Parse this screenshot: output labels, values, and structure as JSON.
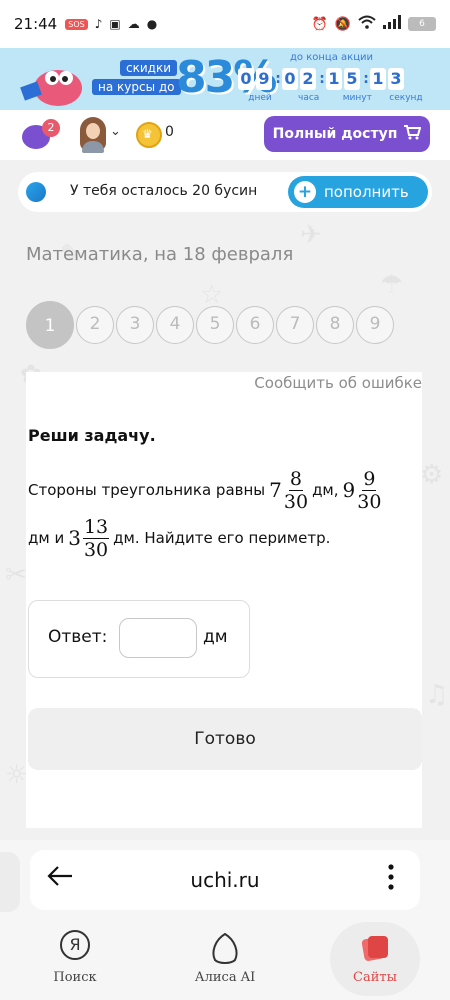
{
  "status_bar": {
    "time": "21:44",
    "sos": "SOS",
    "battery": "6"
  },
  "promo": {
    "line1": "скидки",
    "line2": "на курсы до",
    "percent": "83%",
    "until_label": "до конца акции",
    "timer": {
      "days": [
        "0",
        "9"
      ],
      "hours": [
        "0",
        "2"
      ],
      "minutes": [
        "1",
        "5"
      ],
      "seconds": [
        "1",
        "3"
      ],
      "days_label": "дней",
      "hours_label": "часа",
      "minutes_label": "минут",
      "seconds_label": "секунд"
    }
  },
  "header": {
    "chat_badge": "2",
    "coins": "0",
    "full_access_label": "Полный доступ"
  },
  "beads": {
    "text": "У тебя осталось 20 бусин",
    "topup_label": "пополнить"
  },
  "subject_title": "Математика, на 18 февраля",
  "task_nav": [
    "1",
    "2",
    "3",
    "4",
    "5",
    "6",
    "7",
    "8",
    "9"
  ],
  "card": {
    "report_label": "Сообщить об ошибке",
    "heading": "Реши задачу.",
    "problem": {
      "intro": "Стороны треугольника равны",
      "side1": {
        "whole": "7",
        "num": "8",
        "den": "30"
      },
      "unit_comma1": "дм,",
      "side2": {
        "whole": "9",
        "num": "9",
        "den": "30"
      },
      "unit_and": "дм и",
      "side3": {
        "whole": "3",
        "num": "13",
        "den": "30"
      },
      "tail": "дм. Найдите его периметр."
    },
    "answer_label": "Ответ:",
    "answer_value": "",
    "answer_unit": "дм",
    "done_label": "Готово"
  },
  "browser": {
    "url": "uchi.ru",
    "nav": [
      {
        "label": "Поиск",
        "icon": "yandex-search-icon"
      },
      {
        "label": "Алиса AI",
        "icon": "alice-icon"
      },
      {
        "label": "Сайты",
        "icon": "sites-icon"
      }
    ]
  },
  "colors": {
    "purple": "#7a4fd0",
    "blue": "#27a4e0",
    "active_tab": "#e04545"
  }
}
